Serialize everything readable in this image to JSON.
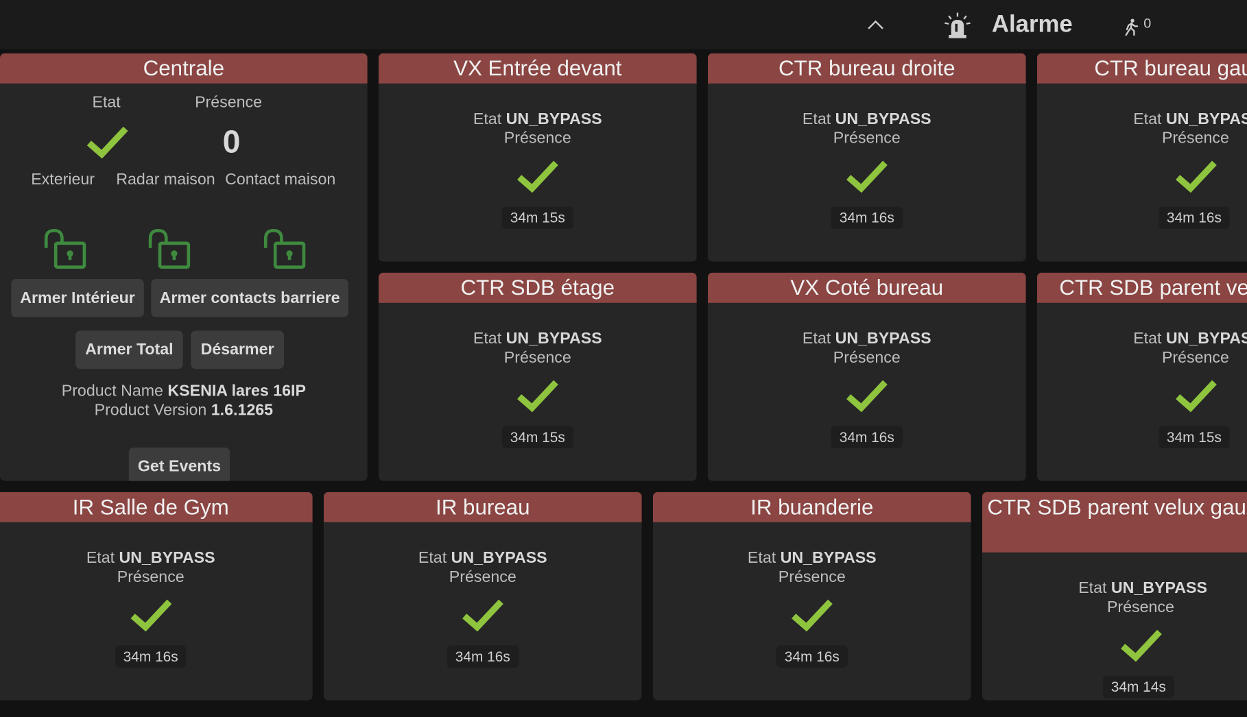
{
  "header": {
    "title": "Alarme",
    "walk_count": "0",
    "icons": [
      "chevron-up-icon",
      "siren-icon",
      "walking-person-icon"
    ]
  },
  "colors": {
    "card_header": "#8b4542",
    "card_bg": "#262626",
    "check": "#8fc43f",
    "lock": "#3f8a3f"
  },
  "centrale": {
    "title": "Centrale",
    "etat_label": "Etat",
    "presence_label": "Présence",
    "presence_value": "0",
    "zones": [
      {
        "label": "Exterieur",
        "icon": "unlocked-padlock-icon"
      },
      {
        "label": "Radar maison",
        "icon": "unlocked-padlock-icon"
      },
      {
        "label": "Contact maison",
        "icon": "unlocked-padlock-icon"
      }
    ],
    "buttons": {
      "armer_interieur": "Armer Intérieur",
      "armer_contacts": "Armer contacts barriere",
      "armer_total": "Armer Total",
      "desarmer": "Désarmer",
      "get_events": "Get Events"
    },
    "product_name_label": "Product Name",
    "product_name": "KSENIA lares 16IP",
    "product_version_label": "Product Version",
    "product_version": "1.6.1265"
  },
  "sensors": [
    {
      "title": "VX Entrée devant",
      "etat_label": "Etat",
      "etat": "UN_BYPASS",
      "presence": "Présence",
      "time": "34m 15s"
    },
    {
      "title": "CTR bureau droite",
      "etat_label": "Etat",
      "etat": "UN_BYPASS",
      "presence": "Présence",
      "time": "34m 16s"
    },
    {
      "title": "CTR bureau gau",
      "etat_label": "Etat",
      "etat": "UN_BYPAS",
      "presence": "Présence",
      "time": "34m 16s"
    },
    {
      "title": "CTR SDB étage",
      "etat_label": "Etat",
      "etat": "UN_BYPASS",
      "presence": "Présence",
      "time": "34m 15s"
    },
    {
      "title": "VX Coté bureau",
      "etat_label": "Etat",
      "etat": "UN_BYPASS",
      "presence": "Présence",
      "time": "34m 16s"
    },
    {
      "title": "CTR SDB parent vel",
      "etat_label": "Etat",
      "etat": "UN_BYPAS",
      "presence": "Présence",
      "time": "34m 15s"
    },
    {
      "title": "IR Salle de Gym",
      "etat_label": "Etat",
      "etat": "UN_BYPASS",
      "presence": "Présence",
      "time": "34m 16s"
    },
    {
      "title": "IR bureau",
      "etat_label": "Etat",
      "etat": "UN_BYPASS",
      "presence": "Présence",
      "time": "34m 16s"
    },
    {
      "title": "IR buanderie",
      "etat_label": "Etat",
      "etat": "UN_BYPASS",
      "presence": "Présence",
      "time": "34m 16s"
    },
    {
      "title": "CTR SDB parent velux gauche",
      "etat_label": "Etat",
      "etat": "UN_BYPASS",
      "presence": "Présence",
      "time": "34m 14s"
    }
  ]
}
